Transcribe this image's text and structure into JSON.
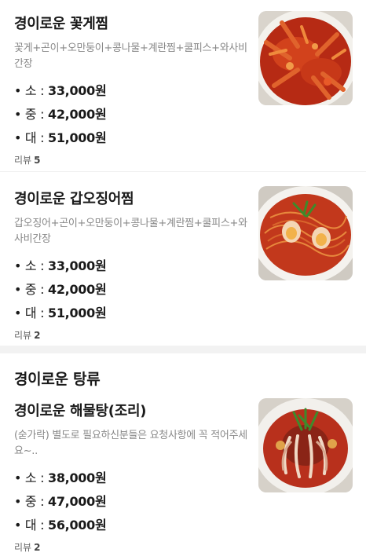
{
  "section1": {
    "items": [
      {
        "name": "경이로운 꽃게찜",
        "description": "꽃게+곤이+오만둥이+콩나물+계란찜+쿨피스+와사비간장",
        "prices": [
          {
            "size": "• 소 : ",
            "price": "33,000원"
          },
          {
            "size": "• 중 : ",
            "price": "42,000원"
          },
          {
            "size": "• 대 : ",
            "price": "51,000원"
          }
        ],
        "review_label": "리뷰",
        "review_count": "5",
        "image_icon": "crab-stew-photo"
      },
      {
        "name": "경이로운 갑오징어찜",
        "description": "갑오징어+곤이+오만둥이+콩나물+계란찜+쿨피스+와사비간장",
        "prices": [
          {
            "size": "• 소 : ",
            "price": "33,000원"
          },
          {
            "size": "• 중 : ",
            "price": "42,000원"
          },
          {
            "size": "• 대 : ",
            "price": "51,000원"
          }
        ],
        "review_label": "리뷰",
        "review_count": "2",
        "image_icon": "cuttlefish-stew-photo"
      }
    ]
  },
  "section2": {
    "title": "경이로운 탕류",
    "items": [
      {
        "name": "경이로운 해물탕(조리)",
        "description": "(숟가락) 별도로 필요하신분들은 요청사항에 꼭 적어주세요~..",
        "prices": [
          {
            "size": "• 소 : ",
            "price": "38,000원"
          },
          {
            "size": "• 중 : ",
            "price": "47,000원"
          },
          {
            "size": "• 대 : ",
            "price": "56,000원"
          }
        ],
        "review_label": "리뷰",
        "review_count": "2",
        "image_icon": "seafood-soup-photo"
      }
    ]
  },
  "colors": {
    "accent_red": "#c8321e",
    "text_dark": "#1a1a1a",
    "text_muted": "#888888",
    "divider": "#f2f2f2"
  }
}
